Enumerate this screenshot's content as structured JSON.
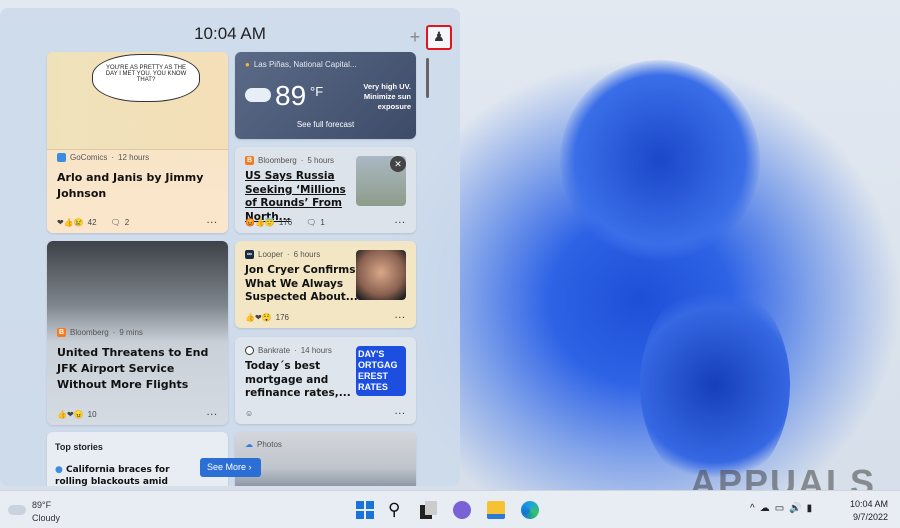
{
  "panel": {
    "time": "10:04 AM",
    "add_icon": "plus-icon",
    "profile_icon": "person-icon"
  },
  "cards": {
    "comic": {
      "source": "GoComics",
      "age": "12 hours",
      "title": "Arlo and Janis by Jimmy Johnson",
      "reactions": "42",
      "comments": "2",
      "bubble": "YOU'RE AS PRETTY AS THE DAY I MET YOU. YOU KNOW THAT?"
    },
    "weather": {
      "location": "Las Piñas, National Capital...",
      "temp": "89",
      "unit": "°F",
      "alert": "Very high UV. Minimize sun exposure",
      "link": "See full forecast"
    },
    "bloomberg1": {
      "source": "Bloomberg",
      "age": "5 hours",
      "title": "US Says Russia Seeking ‘Millions of Rounds’ From North...",
      "reactions": "176",
      "comments": "1"
    },
    "jfk": {
      "source": "Bloomberg",
      "age": "9 mins",
      "title": "United Threatens to End JFK Airport Service Without More Flights",
      "reactions": "10"
    },
    "looper": {
      "source": "Looper",
      "age": "6 hours",
      "title": "Jon Cryer Confirms What We Always Suspected About...",
      "reactions": "176"
    },
    "bankrate": {
      "source": "Bankrate",
      "age": "14 hours",
      "title": "Today´s best mortgage and refinance rates,...",
      "thumb_text": "DAY'S ORTGAG EREST RATES"
    },
    "top": {
      "heading": "Top stories",
      "item": "California braces for rolling blackouts amid"
    },
    "photos": {
      "source": "Photos"
    }
  },
  "see_more": "See More",
  "taskbar": {
    "weather_temp": "89°F",
    "weather_cond": "Cloudy",
    "time": "10:04 AM",
    "date": "9/7/2022",
    "icons": [
      "windows-start-icon",
      "search-icon",
      "task-view-icon",
      "teams-chat-icon",
      "file-explorer-icon",
      "edge-icon"
    ]
  },
  "watermark": "APPUALS"
}
